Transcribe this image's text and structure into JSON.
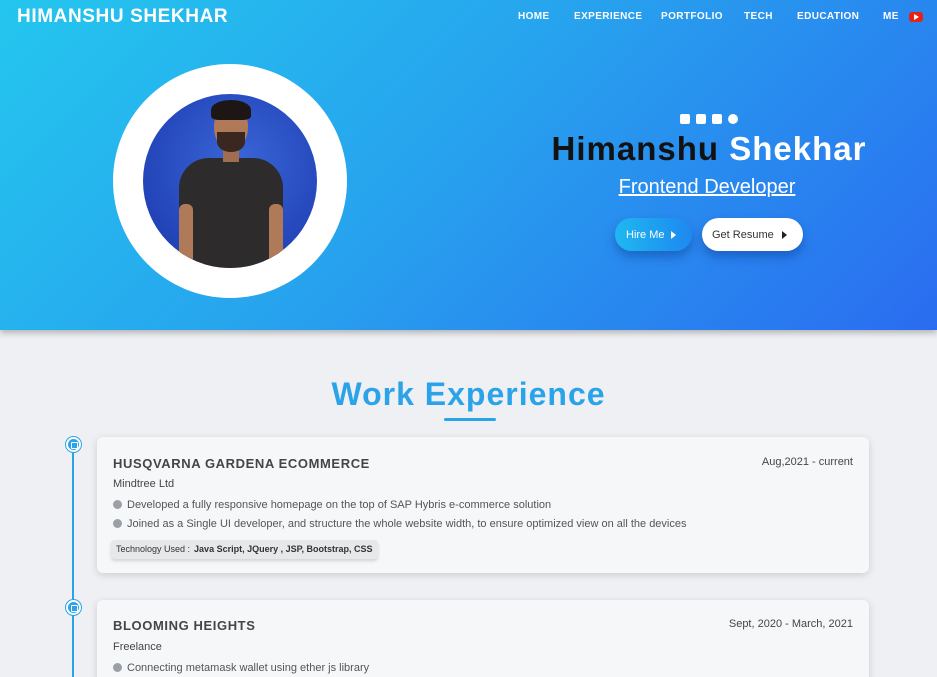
{
  "brand": "HIMANSHU SHEKHAR",
  "nav": [
    "HOME",
    "EXPERIENCE",
    "PORTFOLIO",
    "TECH",
    "EDUCATION",
    "ME"
  ],
  "hero": {
    "first_name": "Himanshu",
    "last_name": "Shekhar",
    "role": "Frontend Developer",
    "hire_label": "Hire Me",
    "resume_label": "Get Resume",
    "social_icons": [
      "youtube-icon",
      "instagram-icon",
      "linkedin-icon",
      "globe-icon"
    ]
  },
  "section_title": "Work Experience",
  "experience": [
    {
      "title": "HUSQVARNA GARDENA ECOMMERCE",
      "date": "Aug,2021 - current",
      "company": "Mindtree Ltd",
      "points": [
        "Developed a fully responsive homepage on the top of SAP Hybris e-commerce solution",
        "Joined as a Single UI developer, and structure the whole website width, to ensure optimized view on all the devices"
      ],
      "tech_label": "Technology Used :",
      "tech": "Java Script, JQuery , JSP, Bootstrap, CSS"
    },
    {
      "title": "BLOOMING HEIGHTS",
      "date": "Sept, 2020 - March, 2021",
      "company": "Freelance",
      "points": [
        "Connecting metamask wallet using ether js library"
      ]
    }
  ],
  "colors": {
    "accent": "#2ba3e8",
    "hero_start": "#24c6ee",
    "hero_end": "#2a6cf0"
  }
}
